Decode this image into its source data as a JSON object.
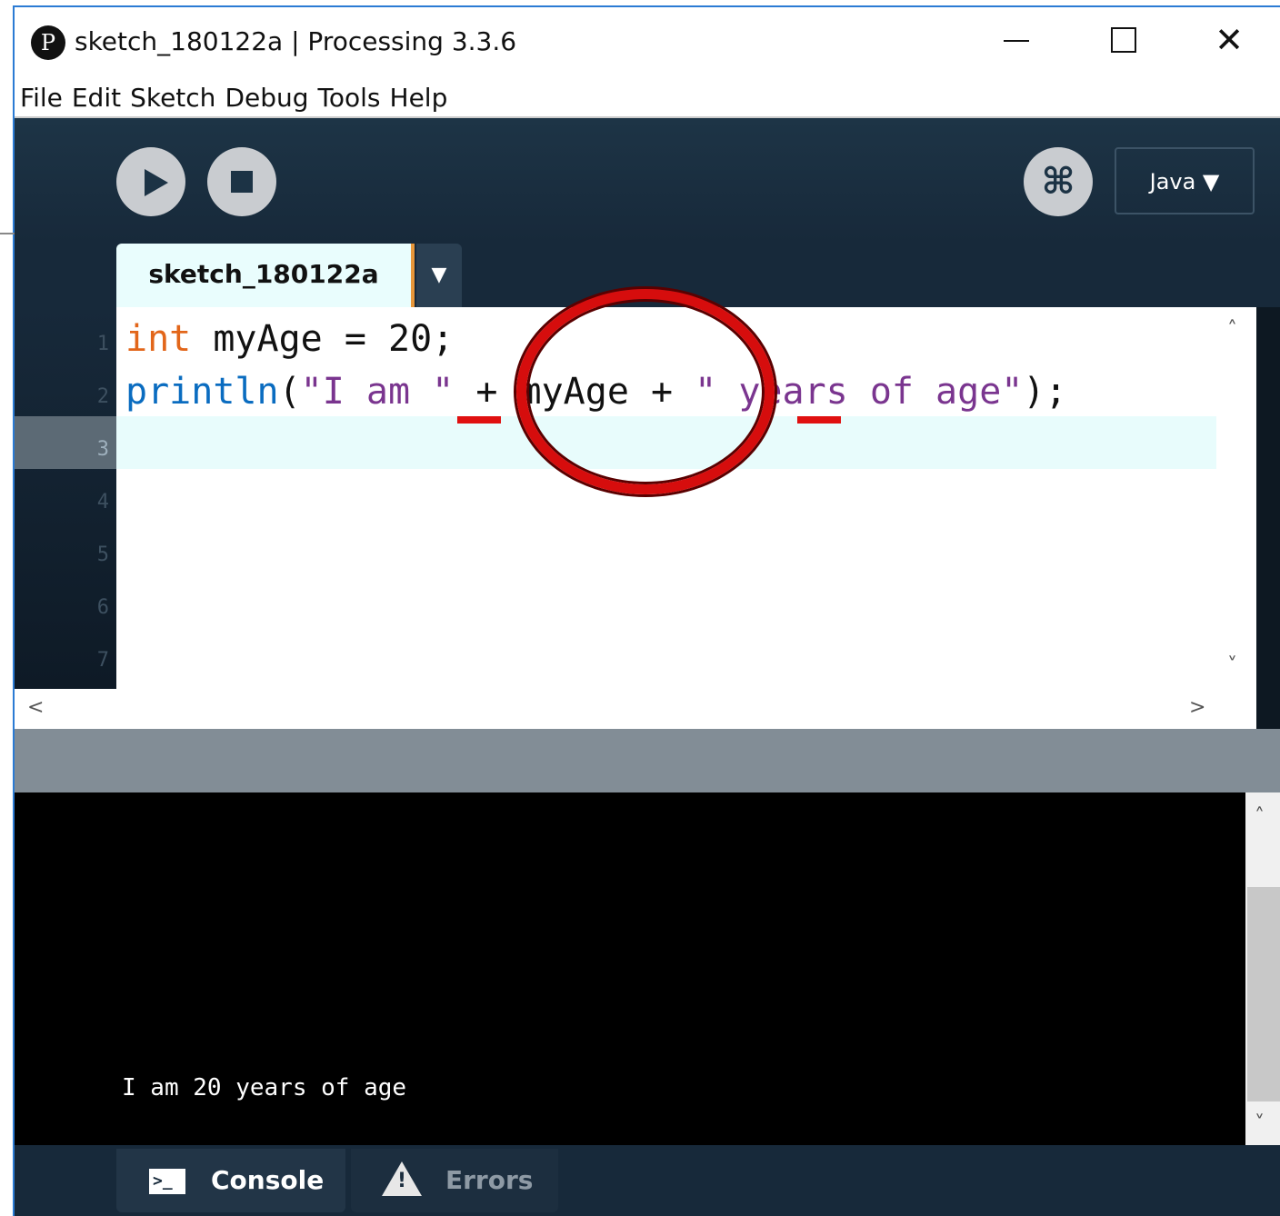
{
  "window": {
    "title": "sketch_180122a | Processing 3.3.6",
    "app_icon_glyph": "P",
    "close_glyph": "✕"
  },
  "menu": [
    "File",
    "Edit",
    "Sketch",
    "Debug",
    "Tools",
    "Help"
  ],
  "toolbar": {
    "debug_glyph": "⌘",
    "mode_label": "Java ▼"
  },
  "tabs": {
    "sketch_name": "sketch_180122a",
    "menu_arrow": "▼"
  },
  "editor": {
    "line_numbers": [
      "1",
      "2",
      "3",
      "4",
      "5",
      "6",
      "7"
    ],
    "current_line": 3,
    "line1": {
      "type": "int",
      "rest": " myAge = 20;"
    },
    "line2": {
      "fn": "println",
      "open": "(",
      "str1": "\"I am \"",
      "mid": " + myAge + ",
      "str2": "\" years of age\"",
      "close": ");"
    },
    "scroll_up": "˄",
    "scroll_down": "˅",
    "scroll_left": "<",
    "scroll_right": ">"
  },
  "console": {
    "output": "I am 20 years of age",
    "scroll_up": "˄",
    "scroll_down": "˅"
  },
  "footer": {
    "console_label": "Console",
    "console_icon_text": ">_",
    "errors_label": "Errors"
  },
  "colors": {
    "keyword": "#e2661a",
    "function": "#0a6cc0",
    "string": "#7a358f",
    "annotation_red": "#d60d0d",
    "toolbar_bg": "#1d3446"
  }
}
